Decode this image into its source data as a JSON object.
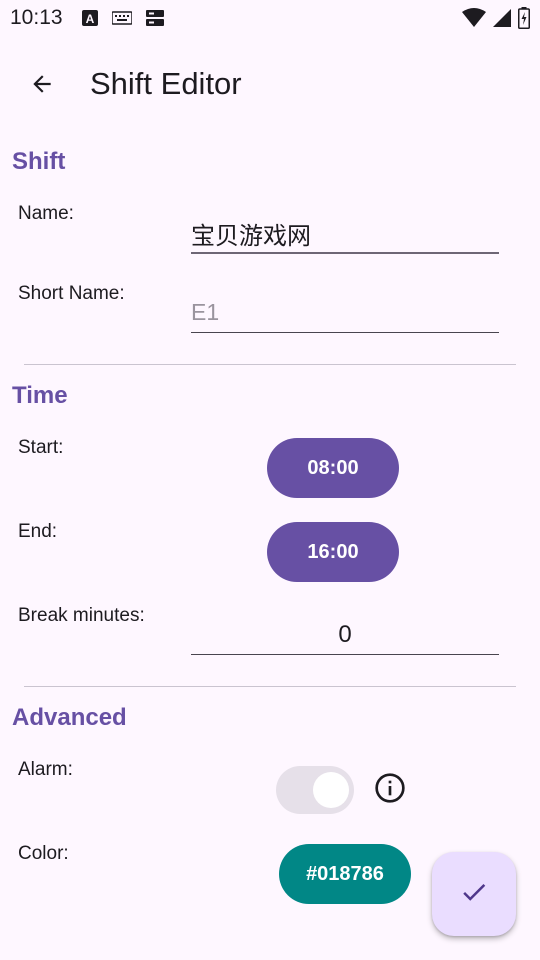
{
  "status_bar": {
    "time": "10:13",
    "left_icons": [
      "translate-a-icon",
      "keyboard-icon",
      "storage-icon"
    ],
    "right_icons": [
      "wifi-icon",
      "cell-signal-icon",
      "battery-charging-icon"
    ]
  },
  "app_bar": {
    "back_icon": "arrow-back-icon",
    "title": "Shift Editor"
  },
  "sections": {
    "shift": {
      "header": "Shift",
      "name_label": "Name:",
      "name_value": "宝贝游戏网",
      "short_name_label": "Short Name:",
      "short_name_placeholder": "E1"
    },
    "time": {
      "header": "Time",
      "start_label": "Start:",
      "start_value": "08:00",
      "end_label": "End:",
      "end_value": "16:00",
      "break_label": "Break minutes:",
      "break_value": "0"
    },
    "advanced": {
      "header": "Advanced",
      "alarm_label": "Alarm:",
      "alarm_enabled": false,
      "info_icon": "info-icon",
      "color_label": "Color:",
      "color_value": "#018786"
    }
  },
  "fab": {
    "icon": "check-icon"
  },
  "colors": {
    "background": "#FEF7FF",
    "primary": "#6750A4",
    "color_button": "#018786",
    "fab": "#EADDFF",
    "switch_track": "#E6E0E9"
  }
}
